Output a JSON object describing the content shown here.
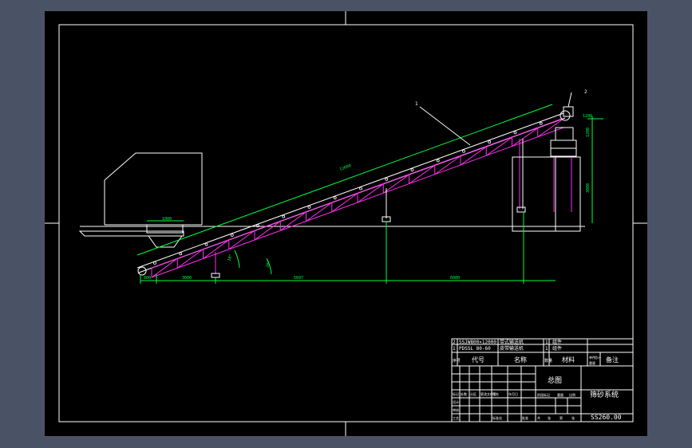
{
  "colors": {
    "workspace": "#4a5366",
    "sheet": "#000000",
    "frame": "#ffffff",
    "steel": "#ffffff",
    "truss": "#ff2df0",
    "dimension": "#00ff3c",
    "leader": "#ffffff",
    "table_text": "#ffffff"
  },
  "callouts": {
    "conveyor_marker": "1",
    "drive_marker": "2"
  },
  "dimensions": {
    "hopper_width": "1000",
    "belt_length": "12000",
    "left_overhang": "800",
    "to_first_support": "3000",
    "to_mid_support": "5697",
    "to_head_support": "6000",
    "head_height": "1200",
    "tower_height": "3000",
    "head_width": "1200",
    "angle_1": "18°",
    "angle_2": "20°"
  },
  "title_block": {
    "parts": [
      {
        "no": "2",
        "code": "SSJW800×12000",
        "name": "带式输送机",
        "qty": "1",
        "material": "组件"
      },
      {
        "no": "1",
        "code": "PDSSL 80-60",
        "name": "皮带输送机",
        "qty": "1",
        "material": "组件"
      }
    ],
    "header": {
      "seq": "序号",
      "code": "代号",
      "name": "名称",
      "qty": "数量",
      "material": "材料",
      "single": "单件",
      "total": "总计",
      "weight": "重量",
      "remarks": "备注"
    },
    "assembly": "总图",
    "system_name": "筛砂系统",
    "drawing_code": "SS260.00",
    "rev_cols": [
      "标记",
      "处数",
      "分区",
      "更改文件号",
      "签名",
      "年月日"
    ],
    "stage_cols": [
      "阶段标记",
      "重量",
      "比例"
    ],
    "sign_rows": [
      "设计",
      "审核",
      "工艺",
      "标准化",
      "批准"
    ],
    "footer": [
      "共",
      "张",
      "第",
      "张"
    ]
  }
}
